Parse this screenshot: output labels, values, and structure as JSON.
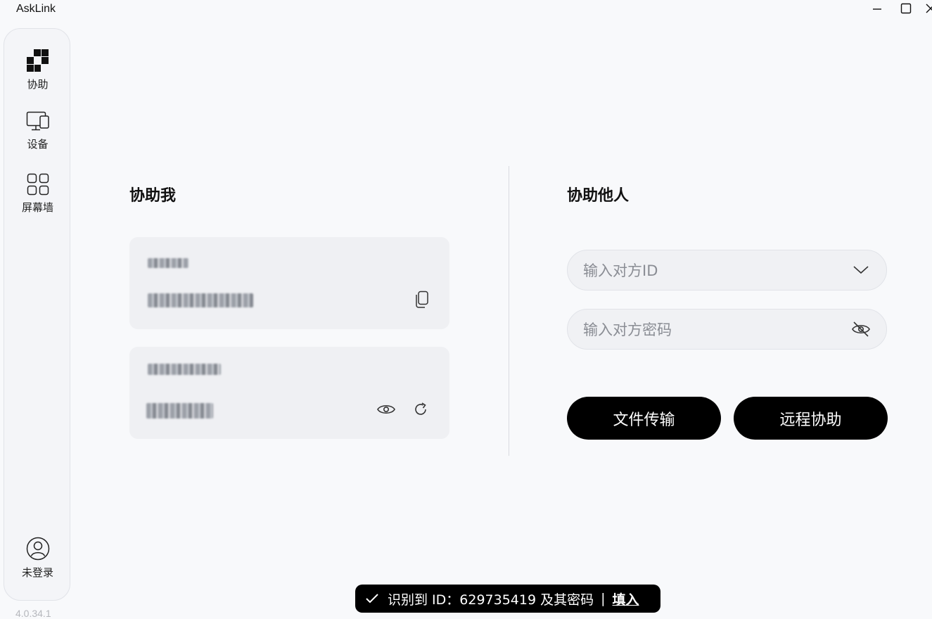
{
  "app": {
    "title": "AskLink"
  },
  "sidebar": {
    "items": [
      {
        "label": "协助",
        "icon": "assist-icon"
      },
      {
        "label": "设备",
        "icon": "devices-icon"
      },
      {
        "label": "屏幕墙",
        "icon": "screen-wall-icon"
      }
    ],
    "user": {
      "label": "未登录",
      "icon": "user-icon"
    },
    "version": "4.0.34.1"
  },
  "help_me": {
    "title": "协助我"
  },
  "help_others": {
    "title": "协助他人",
    "id_placeholder": "输入对方ID",
    "password_placeholder": "输入对方密码",
    "file_transfer_label": "文件传输",
    "remote_assist_label": "远程协助"
  },
  "toast": {
    "message": "识别到 ID：629735419 及其密码",
    "separator": "|",
    "action": "填入"
  },
  "colors": {
    "accent": "#000000",
    "card_bg": "#eff0f3",
    "page_bg": "#f8f9fb"
  }
}
